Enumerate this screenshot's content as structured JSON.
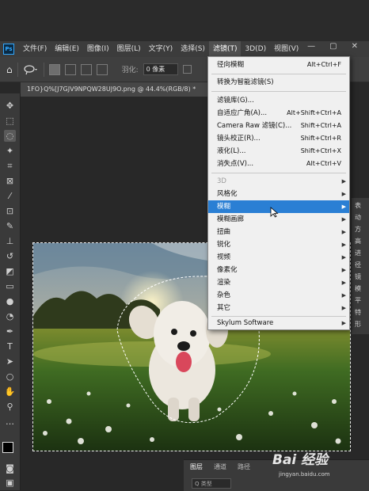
{
  "app": {
    "logo": "Ps"
  },
  "menubar": [
    {
      "label": "文件(F)"
    },
    {
      "label": "编辑(E)"
    },
    {
      "label": "图像(I)"
    },
    {
      "label": "图层(L)"
    },
    {
      "label": "文字(Y)"
    },
    {
      "label": "选择(S)"
    },
    {
      "label": "滤镜(T)",
      "active": true
    },
    {
      "label": "3D(D)"
    },
    {
      "label": "视图(V)"
    }
  ],
  "window_controls": {
    "minimize": "—",
    "maximize": "▢",
    "close": "✕"
  },
  "options": {
    "feather_label": "羽化:",
    "feather_value": "0 像素"
  },
  "document": {
    "tab_title": "1FO}Q%[J7GJV9NPQW28UJ9O.png @ 44.4%(RGB/8) *"
  },
  "filter_menu": {
    "last_filter": {
      "label": "径向模糊",
      "shortcut": "Alt+Ctrl+F"
    },
    "smart": {
      "label": "转换为智能滤镜(S)"
    },
    "group1": [
      {
        "label": "滤镜库(G)...",
        "shortcut": ""
      },
      {
        "label": "自适应广角(A)...",
        "shortcut": "Alt+Shift+Ctrl+A"
      },
      {
        "label": "Camera Raw 滤镜(C)...",
        "shortcut": "Shift+Ctrl+A"
      },
      {
        "label": "镜头校正(R)...",
        "shortcut": "Shift+Ctrl+R"
      },
      {
        "label": "液化(L)...",
        "shortcut": "Shift+Ctrl+X"
      },
      {
        "label": "消失点(V)...",
        "shortcut": "Alt+Ctrl+V"
      }
    ],
    "group2": [
      {
        "label": "3D",
        "disabled": true
      },
      {
        "label": "风格化"
      },
      {
        "label": "模糊",
        "highlight": true
      },
      {
        "label": "模糊画廊"
      },
      {
        "label": "扭曲"
      },
      {
        "label": "锐化"
      },
      {
        "label": "视频"
      },
      {
        "label": "像素化"
      },
      {
        "label": "渲染"
      },
      {
        "label": "杂色"
      },
      {
        "label": "其它"
      }
    ],
    "plugin": {
      "label": "Skylum Software"
    }
  },
  "side_panel_chars": [
    "表",
    "动",
    "方",
    "高",
    "进",
    "径",
    "镜",
    "模",
    "平",
    "特",
    "形"
  ],
  "layers_panel": {
    "tabs": [
      "图层",
      "通道",
      "路径"
    ],
    "search_placeholder": "Q 类型"
  },
  "watermark": {
    "brand": "Bai 经验",
    "url": "jingyan.baidu.com"
  },
  "colors": {
    "menu_highlight": "#2a7fd4",
    "ui_dark": "#3c3c3c",
    "ps_blue": "#31a8ff"
  }
}
